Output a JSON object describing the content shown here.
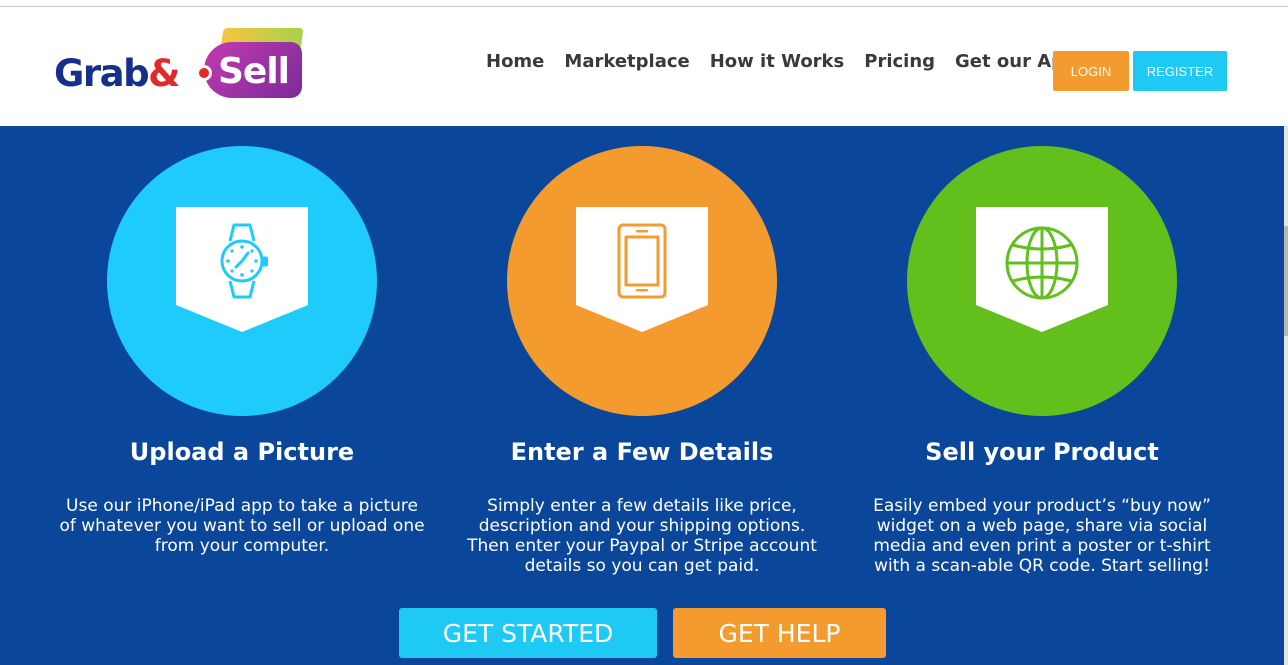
{
  "brand": {
    "part1": "Grab",
    "amp": "&",
    "part2": "Sell"
  },
  "nav": [
    {
      "label": "Home"
    },
    {
      "label": "Marketplace"
    },
    {
      "label": "How it Works"
    },
    {
      "label": "Pricing"
    },
    {
      "label": "Get our App"
    }
  ],
  "auth": {
    "login": "LOGIN",
    "register": "REGISTER"
  },
  "steps": [
    {
      "title": "Upload a Picture",
      "text": "Use our iPhone/iPad app to take a picture of whatever you want to sell or upload one from your computer.",
      "icon": "watch-icon",
      "color": "#1fcbfb"
    },
    {
      "title": "Enter a Few Details",
      "text": "Simply enter a few details like price, description and your shipping options. Then enter your Paypal or Stripe account details so you can get paid.",
      "icon": "tablet-icon",
      "color": "#f49b30"
    },
    {
      "title": "Sell your Product",
      "text": "Easily embed your product’s “buy now” widget on a web page, share via social media and even print a poster or t-shirt with a scan-able QR code. Start selling!",
      "icon": "globe-icon",
      "color": "#62bf1c"
    }
  ],
  "cta": {
    "get_started": "GET STARTED",
    "get_help": "GET HELP"
  },
  "colors": {
    "background": "#0a4699",
    "orange": "#f49b30",
    "cyan": "#1ec9f4",
    "green": "#62bf1c"
  }
}
